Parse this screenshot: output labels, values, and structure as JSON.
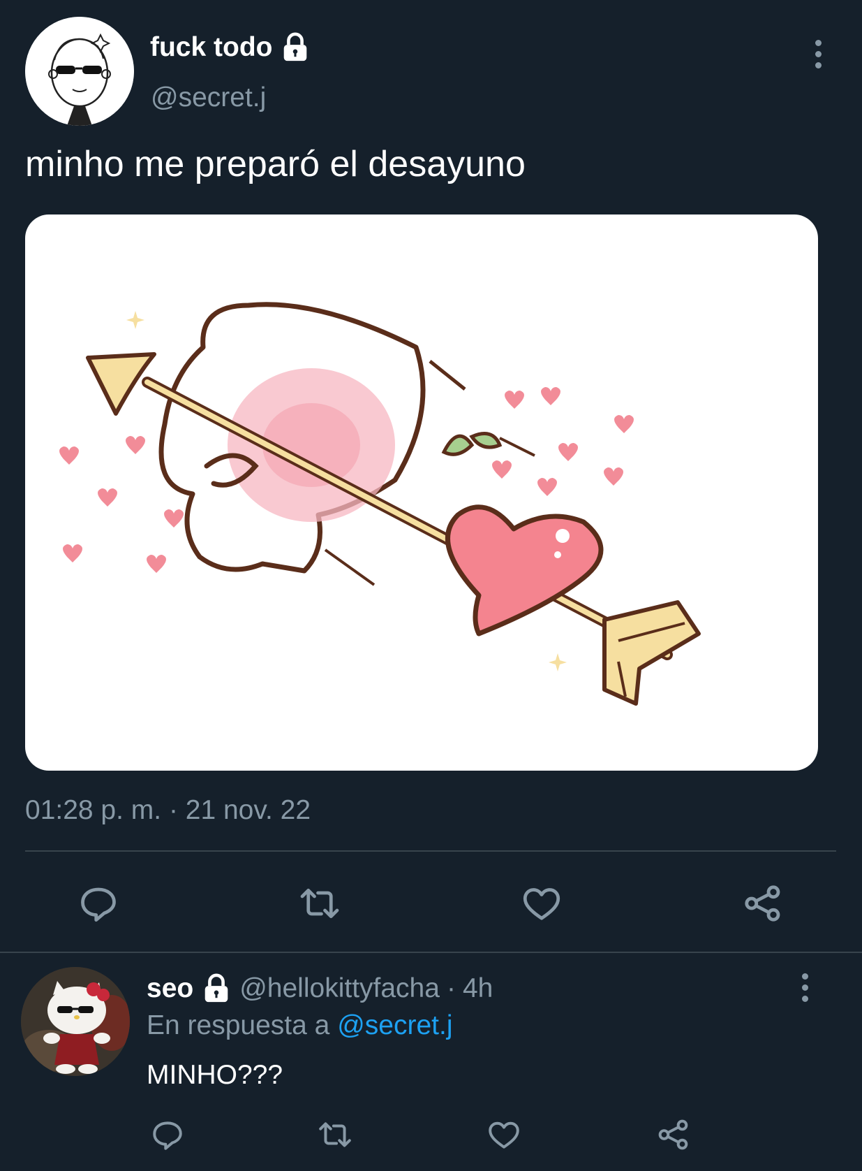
{
  "tweet": {
    "display_name": "fuck todo",
    "handle": "@secret.j",
    "text": "minho me preparó el desayuno",
    "timestamp": "01:28 p. m. · 21 nov. 22",
    "avatar_icon": "cartoon-avatar-with-sunglasses",
    "protected_icon": "lock-icon",
    "media_icon": "cartoon-character-hit-by-heart-arrow"
  },
  "actions": {
    "reply_icon": "reply-icon",
    "retweet_icon": "retweet-icon",
    "like_icon": "heart-icon",
    "share_icon": "share-icon"
  },
  "reply": {
    "display_name": "seo",
    "handle": "@hellokittyfacha",
    "separator": "·",
    "time": "4h",
    "reply_prefix": "En respuesta a",
    "reply_to": "@secret.j",
    "text": "MINHO???",
    "avatar_icon": "hello-kitty-sunglasses-avatar"
  },
  "colors": {
    "background": "#15202b",
    "muted": "#8899a6",
    "link": "#1da1f2",
    "divider": "#38444d"
  }
}
